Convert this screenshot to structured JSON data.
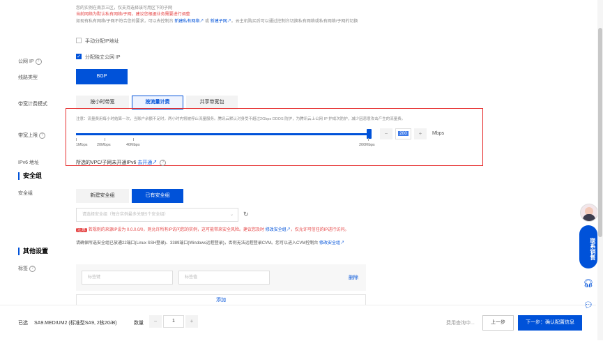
{
  "notices": {
    "line1": "您的实例在南京三区，仅支持选择该可用区下的子网",
    "line2": "当前网络为默认私有网络/子网，建议您根据业务需要进行调整",
    "line3_prefix": "如现有私有网络/子网不符合您的要求，可以去控制台",
    "line3_link1": "新建私有网络",
    "line3_or": "或",
    "line3_link2": "新建子网",
    "line3_suffix": "。云主机购买后可以通过控制台切换私有网络或私有网络/子网的切换"
  },
  "network": {
    "manual_ip_label": "手动分配IP地址",
    "public_ip_label": "公网 IP",
    "public_ip_checkbox": "分配独立公网 IP",
    "line_type_label": "线路类型",
    "line_type_value": "BGP",
    "billing_label": "带宽计费模式",
    "billing_tabs": [
      "按小时带宽",
      "按流量计费",
      "共享带宽包"
    ],
    "billing_active_index": 1,
    "note": "注意：流量费用每小时结算一次，当账户余额不足时，两小时内将被停止流量服务。腾讯云默认对身受不超过2Gbps DDOS 防护，为腾讯云上公网 IP 护成次防护，减少因恶意攻击产生的流量费。",
    "bandwidth_label": "带宽上限",
    "bandwidth_value": "200",
    "bandwidth_unit": "Mbps",
    "bandwidth_fraction": 1.0,
    "ticks": [
      "1Mbps",
      "20Mbps",
      "40Mbps",
      "200Mbps"
    ],
    "ipv6_label": "IPv6 地址",
    "ipv6_text": "所选的VPC/子网未开通IPv6",
    "ipv6_link": "去开通"
  },
  "security": {
    "title": "安全组",
    "label": "安全组",
    "tabs": [
      "新建安全组",
      "已有安全组"
    ],
    "active_index": 1,
    "select_placeholder": "请选择安全组（每台实例最多关联5个安全组）",
    "warning_badge": "注意",
    "warning_text": "若规则的来源IP设为 0.0.0.0/0，则允许所有IP访问您的实例，这可能带来安全风险。建议您及时",
    "warning_link": "修改安全组",
    "warning_suffix": "，仅允许可信任的IP进行访问。",
    "ports_text": "请确保所选安全组已放通22端口(Linux SSH登录)、3389端口(Windows远程登录)，否则无法远程登录CVM。您可以进入CVM控制台",
    "ports_link": "修改安全组"
  },
  "other": {
    "title": "其他设置",
    "tag_label": "标签",
    "tag_key_placeholder": "标签键",
    "tag_value_placeholder": "标签值",
    "delete_label": "删除",
    "add_label": "添加"
  },
  "footer": {
    "selected_label": "已选",
    "selected_value": "SA9.MEDIUM2 (标准型SA9, 2核2GiB)",
    "quantity_label": "数量",
    "quantity_value": "1",
    "minus": "−",
    "plus": "+",
    "price_status": "费用查询中...",
    "prev_button": "上一步",
    "next_button": "下一步：确认配置信息"
  },
  "side": {
    "contact_label": "联系销售",
    "headset_icon": "headset-icon",
    "chat_icon": "chat-icon"
  },
  "colors": {
    "primary": "#0052d9",
    "danger": "#e54545",
    "highlight_box": "#e62e2e"
  }
}
